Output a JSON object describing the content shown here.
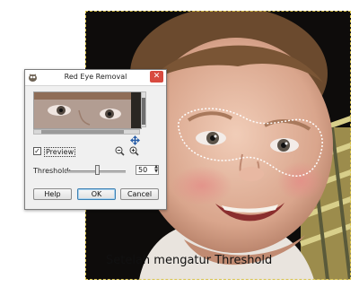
{
  "caption": "Setelah mengatur Threshold",
  "dialog": {
    "title": "Red Eye Removal",
    "close_glyph": "✕",
    "preview_label": "Preview",
    "preview_checked": true,
    "threshold_label": "Threshold:",
    "threshold_value": "50",
    "threshold_level_pct": 50,
    "buttons": {
      "help": "Help",
      "ok": "OK",
      "cancel": "Cancel"
    }
  },
  "icons": [
    "gimp-app-icon",
    "close-icon",
    "move-icon",
    "zoom-out-icon",
    "zoom-in-icon",
    "spin-arrows-icon"
  ],
  "colors": {
    "selection_outline": "#ffffff",
    "canvas_boundary": "#d8c24a",
    "close_button": "#d84a3f",
    "default_button_border": "#3c7fb1"
  }
}
